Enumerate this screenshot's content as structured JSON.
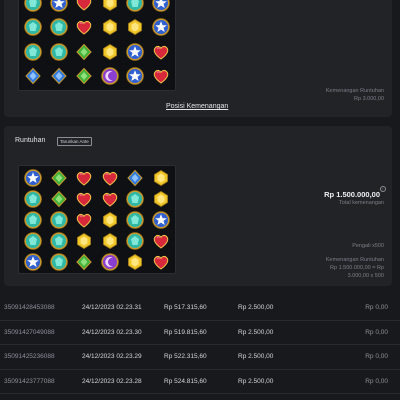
{
  "top_card": {
    "position_link": "Posisi Kemenangan",
    "win_label": "Kemenangan Runtuhan",
    "win_value": "Rp 3.000,00",
    "grid": [
      [
        "blue-star",
        "teal-gem",
        "red-heart",
        "red-heart",
        "teal-gem",
        "blue-star"
      ],
      [
        "teal-gem",
        "blue-star",
        "red-heart",
        "yellow-gem",
        "teal-gem",
        "blue-star"
      ],
      [
        "teal-gem",
        "teal-gem",
        "red-heart",
        "yellow-gem",
        "yellow-gem",
        "blue-star"
      ],
      [
        "teal-gem",
        "teal-gem",
        "green-gem",
        "yellow-gem",
        "blue-star",
        "red-heart"
      ],
      [
        "blue-gem",
        "blue-gem",
        "green-gem",
        "purple-orb",
        "blue-star",
        "red-heart"
      ]
    ]
  },
  "cascade_card": {
    "title": "Runtuhan",
    "badge": "Tarunkan Ante",
    "big_amount": "Rp 1.500.000,00",
    "total_label": "Total kemenangan",
    "multiplier": "Pengali x500",
    "win_label": "Kemenangan Runtuhan",
    "formula_line1": "Rp 1.500.000,00 = Rp",
    "formula_line2": "3.000,00 x 500",
    "grid": [
      [
        "blue-star",
        "green-gem",
        "red-heart",
        "red-heart",
        "blue-gem",
        "yellow-gem"
      ],
      [
        "teal-gem",
        "green-gem",
        "red-heart",
        "red-heart",
        "teal-gem",
        "yellow-gem"
      ],
      [
        "teal-gem",
        "teal-gem",
        "red-heart",
        "yellow-gem",
        "teal-gem",
        "blue-star"
      ],
      [
        "teal-gem",
        "teal-gem",
        "yellow-gem",
        "yellow-gem",
        "teal-gem",
        "red-heart"
      ],
      [
        "blue-star",
        "teal-gem",
        "green-gem",
        "purple-orb",
        "yellow-gem",
        "red-heart"
      ]
    ]
  },
  "rows": [
    {
      "id": "35091428453088",
      "date": "24/12/2023 02.23.31",
      "win": "Rp 517.315,60",
      "bet": "Rp 2.500,00",
      "result": "Rp 0,00"
    },
    {
      "id": "35091427049088",
      "date": "24/12/2023 02.23.30",
      "win": "Rp 519.815,60",
      "bet": "Rp 2.500,00",
      "result": "Rp 0,00"
    },
    {
      "id": "35091425236088",
      "date": "24/12/2023 02.23.29",
      "win": "Rp 522.315,60",
      "bet": "Rp 2.500,00",
      "result": "Rp 0,00"
    },
    {
      "id": "35091423777088",
      "date": "24/12/2023 02.23.28",
      "win": "Rp 524.815,60",
      "bet": "Rp 2.500,00",
      "result": "Rp 0,00"
    }
  ],
  "colors": {
    "teal-gem": "#2fb8a6",
    "blue-star": "#2f5fd0",
    "red-heart": "#d8283c",
    "yellow-gem": "#f0c628",
    "green-gem": "#3fb33a",
    "blue-gem": "#2f7ae0",
    "purple-orb": "#8b3fd0"
  }
}
